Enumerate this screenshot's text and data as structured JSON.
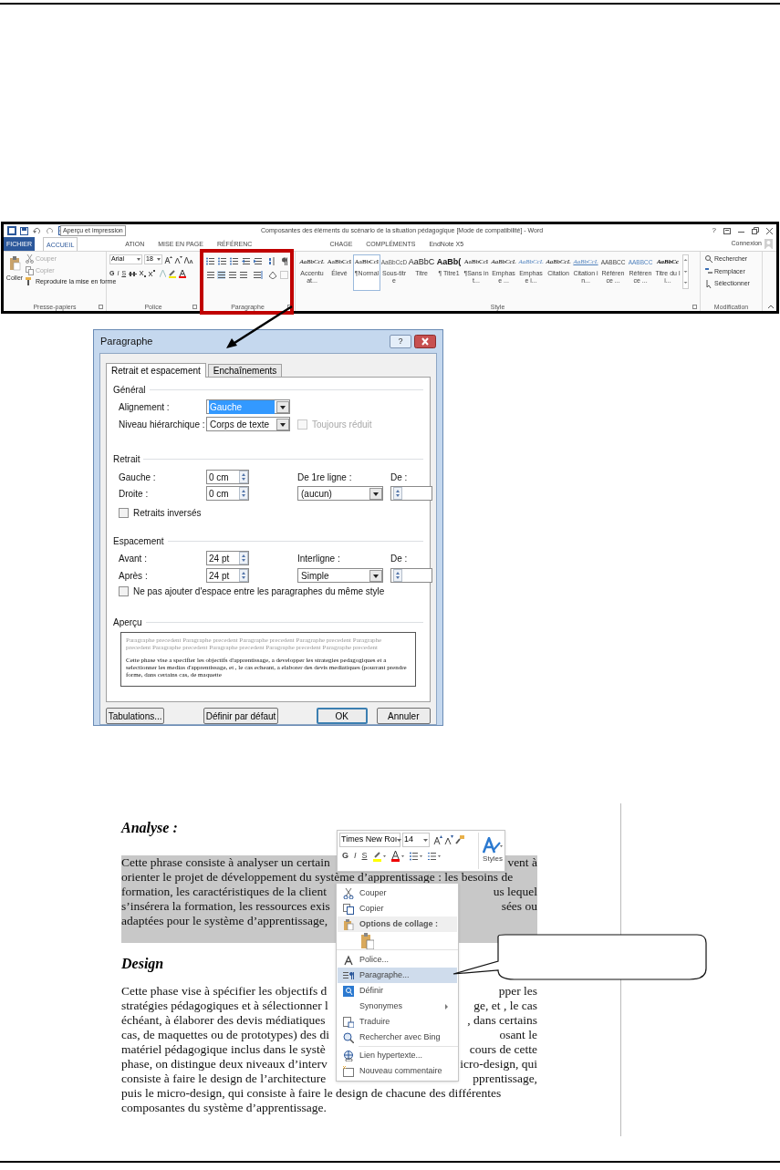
{
  "ribbon": {
    "title": "Composantes des éléments du scénario de la situation pédagogique [Mode de compatibilité] - Word",
    "help": "?",
    "tooltip": "Aperçu et impression",
    "tabs": [
      {
        "label": "FICHIER",
        "selected": false,
        "kind": "file"
      },
      {
        "label": "ACCUEIL",
        "selected": true,
        "kind": "tab"
      },
      {
        "label": "ATION",
        "selected": false,
        "kind": "tab"
      },
      {
        "label": "MISE EN PAGE",
        "selected": false,
        "kind": "tab"
      },
      {
        "label": "RÉFÉRENC",
        "selected": false,
        "kind": "tab"
      },
      {
        "label": "CHAGE",
        "selected": false,
        "kind": "tab"
      },
      {
        "label": "COMPLÉMENTS",
        "selected": false,
        "kind": "tab"
      },
      {
        "label": "EndNote X5",
        "selected": false,
        "kind": "tab"
      }
    ],
    "account": "Connexion",
    "clipboard": {
      "paste": "Coller",
      "items": [
        {
          "label": "Couper",
          "disabled": true
        },
        {
          "label": "Copier",
          "disabled": true
        },
        {
          "label": "Reproduire la mise en forme",
          "disabled": false
        }
      ]
    },
    "font": {
      "name": "Arial",
      "size": "18",
      "format_letters": [
        "G",
        "I",
        "S"
      ]
    },
    "styles": [
      {
        "sample": "AaBbCcL",
        "label": "Accentuat...",
        "kind": "italic",
        "selected": false
      },
      {
        "sample": "AaBbCcI",
        "label": "Élevé",
        "kind": "serif",
        "selected": false
      },
      {
        "sample": "AaBbCcI",
        "label": "¶Normal",
        "kind": "serif",
        "selected": true
      },
      {
        "sample": "AaBbCcD",
        "label": "Sous-titre",
        "kind": "plain",
        "selected": false
      },
      {
        "sample": "AaBbC",
        "label": "Titre",
        "kind": "heading",
        "selected": false
      },
      {
        "sample": "AaBb(",
        "label": "¶ Titre1",
        "kind": "heading-bold",
        "selected": false
      },
      {
        "sample": "AaBbCcI",
        "label": "¶Sans int...",
        "kind": "serif",
        "selected": false
      },
      {
        "sample": "AaBbCcL",
        "label": "Emphase ...",
        "kind": "italic",
        "selected": false
      },
      {
        "sample": "AaBbCcL",
        "label": "Emphase i...",
        "kind": "blue-italic",
        "selected": false
      },
      {
        "sample": "AaBbCcL",
        "label": "Citation",
        "kind": "italic",
        "selected": false
      },
      {
        "sample": "AaBbCcL",
        "label": "Citation in...",
        "kind": "blue-underline",
        "selected": false
      },
      {
        "sample": "AABBCC",
        "label": "Référence ...",
        "kind": "caps",
        "selected": false
      },
      {
        "sample": "AABBCC",
        "label": "Référence ...",
        "kind": "blue-caps",
        "selected": false
      },
      {
        "sample": "AaBbCc",
        "label": "Titre du li...",
        "kind": "bold-italic",
        "selected": false
      }
    ],
    "editing": [
      {
        "label": "Rechercher",
        "kind": "find"
      },
      {
        "label": "Remplacer",
        "kind": "replace"
      },
      {
        "label": "Sélectionner",
        "kind": "select"
      }
    ],
    "groups": [
      "Presse-papiers",
      "Police",
      "Paragraphe",
      "Style",
      "Modification"
    ]
  },
  "dialog": {
    "title": "Paragraphe",
    "help": "?",
    "tabs": [
      {
        "label": "Retrait et espacement",
        "selected": true
      },
      {
        "label": "Enchaînements",
        "selected": false
      }
    ],
    "general": {
      "heading": "Général",
      "alignment": {
        "label": "Alignement :",
        "value": "Gauche"
      },
      "outline_level": {
        "label": "Niveau hiérarchique :",
        "value": "Corps de texte"
      },
      "collapsed": {
        "label": "Toujours réduit",
        "checked": false,
        "disabled": true
      }
    },
    "indent": {
      "heading": "Retrait",
      "left": {
        "label": "Gauche :",
        "value": "0 cm"
      },
      "right": {
        "label": "Droite :",
        "value": "0 cm"
      },
      "special": {
        "label": "De 1re ligne :",
        "value": "(aucun)"
      },
      "by": {
        "label": "De :"
      },
      "mirror": {
        "label": "Retraits inversés",
        "checked": false,
        "disabled": false
      }
    },
    "spacing": {
      "heading": "Espacement",
      "before": {
        "label": "Avant :",
        "value": "24 pt"
      },
      "after": {
        "label": "Après :",
        "value": "24 pt"
      },
      "line_spacing": {
        "label": "Interligne :",
        "value": "Simple"
      },
      "at": {
        "label": "De :"
      },
      "dont_add": {
        "label": "Ne pas ajouter d'espace entre les paragraphes du même style",
        "checked": false,
        "disabled": false
      }
    },
    "preview": {
      "heading": "Aperçu",
      "previous": [
        "Paragraphe precedent Paragraphe precedent Paragraphe precedent Paragraphe precedent Paragraphe",
        "precedent Paragraphe precedent Paragraphe precedent Paragraphe precedent Paragraphe precedent"
      ],
      "current": [
        "Cette phase vise a specifier les objectifs d'apprentissage, a developper les strategies pedagogiques et a",
        "selectionner les medias d'apprentissage, et , le cas echeant, a elaborer des devis mediatiques (pourrant prendre",
        "forme, dans certains cas, de maquette"
      ]
    },
    "buttons": [
      {
        "label": "Tabulations...",
        "default": false
      },
      {
        "label": "Définir par défaut",
        "default": false
      },
      {
        "label": "OK",
        "default": true
      },
      {
        "label": "Annuler",
        "default": false
      }
    ]
  },
  "document": {
    "sections": [
      {
        "heading": "Analyse :",
        "highlighted": true,
        "lines": [
          {
            "left": "Cette phrase consiste à analyser un certain",
            "right": "vent à"
          },
          {
            "left": "orienter le projet de développement du système d’apprentissage : les besoins de"
          },
          {
            "left": "formation, les caractéristiques de la client",
            "right": "us lequel"
          },
          {
            "left": "s’insérera la formation, les ressources exis",
            "right": "sées ou"
          },
          {
            "left": "adaptées pour le système d’apprentissage,"
          }
        ]
      },
      {
        "heading": "Design",
        "highlighted": false,
        "lines": [
          {
            "left": "Cette phase vise à spécifier les objectifs d",
            "right": "pper les"
          },
          {
            "left": "stratégies pédagogiques et à sélectionner l",
            "right": "ge, et , le cas"
          },
          {
            "left": "échéant, à élaborer des devis médiatiques",
            "right": ", dans certains"
          },
          {
            "left": "cas, de maquettes ou de prototypes) des di",
            "right": "osant le"
          },
          {
            "left": "matériel pédagogique inclus dans le systè",
            "right": "cours de cette"
          },
          {
            "left": "phase, on distingue deux niveaux d’interv",
            "right": "icro-design, qui"
          },
          {
            "left": "consiste à faire le design de l’architecture",
            "right": "pprentissage,"
          },
          {
            "left": "puis le micro-design, qui consiste à faire le design de chacune des différentes"
          },
          {
            "left": "composantes du système d’apprentissage."
          }
        ]
      }
    ]
  },
  "mini_toolbar": {
    "font": "Times New Roı",
    "size": "14",
    "letters": [
      "G",
      "I",
      "S"
    ],
    "styles": "Styles"
  },
  "context_menu": {
    "items": [
      {
        "kind": "item",
        "label": "Couper",
        "selected": false
      },
      {
        "kind": "item",
        "label": "Copier",
        "selected": false
      },
      {
        "kind": "header",
        "label": "Options de collage :",
        "selected": false
      },
      {
        "kind": "paste-row",
        "selected": false
      },
      {
        "kind": "item",
        "label": "Police...",
        "selected": false
      },
      {
        "kind": "item",
        "label": "Paragraphe...",
        "selected": true
      },
      {
        "kind": "item",
        "label": "Définir",
        "selected": false
      },
      {
        "kind": "submenu",
        "label": "Synonymes",
        "selected": false
      },
      {
        "kind": "item",
        "label": "Traduire",
        "selected": false
      },
      {
        "kind": "item",
        "label": "Rechercher avec Bing",
        "selected": false
      },
      {
        "kind": "item",
        "label": "Lien hypertexte...",
        "selected": false
      },
      {
        "kind": "item",
        "label": "Nouveau commentaire",
        "selected": false
      }
    ]
  }
}
